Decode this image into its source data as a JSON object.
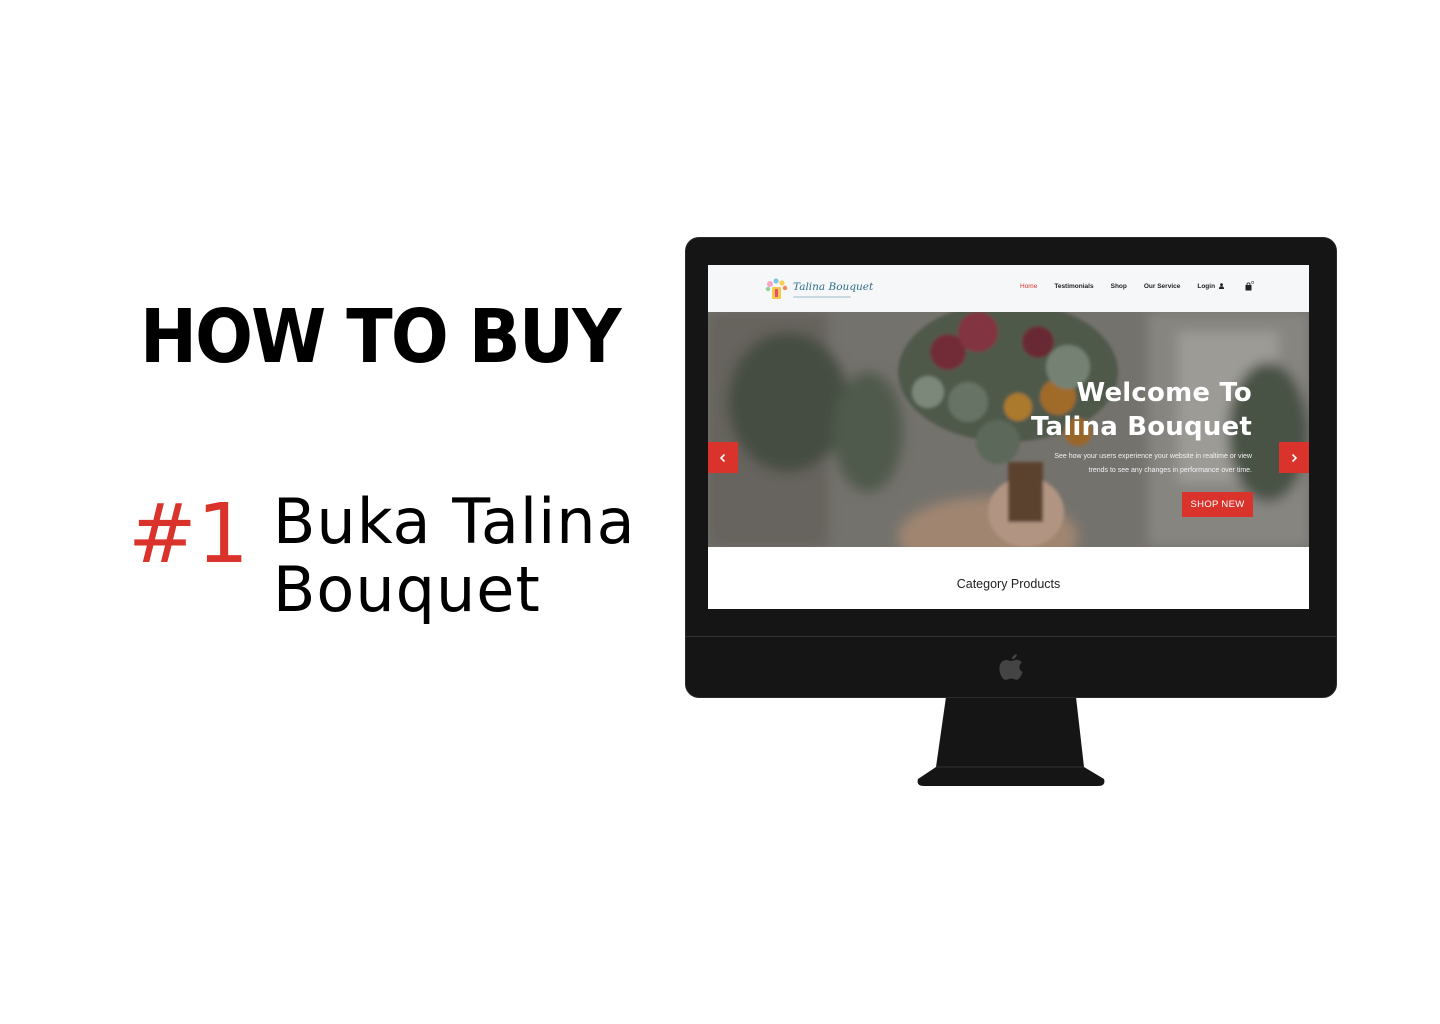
{
  "heading": "HOW TO BUY",
  "step": {
    "number": "#1",
    "line1": "Buka Talina",
    "line2": "Bouquet"
  },
  "site": {
    "brand": "Talina Bouquet",
    "nav": {
      "home": "Home",
      "testimonials": "Testimonials",
      "shop": "Shop",
      "service": "Our Service",
      "login": "Login"
    },
    "hero": {
      "title_line1": "Welcome To",
      "title_line2": "Talina Bouquet",
      "subtitle_line1": "See how your users experience your website in realtime or view",
      "subtitle_line2": "trends to see any changes in performance over time.",
      "cta": "SHOP NEW"
    },
    "section_title": "Category Products"
  },
  "colors": {
    "accent": "#d9332b",
    "monitor": "#151515",
    "header_bg": "#f6f7f8"
  },
  "icons": {
    "apple": "apple-logo-icon",
    "user": "user-icon",
    "cart": "shopping-bag-icon",
    "prev": "chevron-left-icon",
    "next": "chevron-right-icon"
  }
}
